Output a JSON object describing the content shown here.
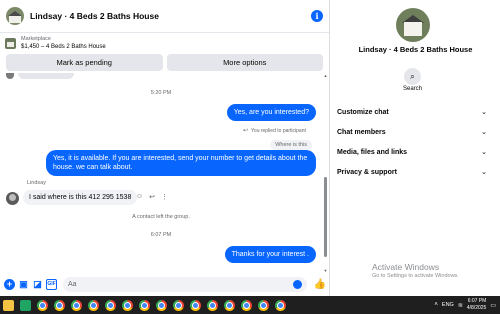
{
  "header": {
    "title": "Lindsay · 4 Beds 2 Baths House",
    "info_icon": "i"
  },
  "marketplace": {
    "label": "Marketplace",
    "item": "$1,450 – 4 Beds 2 Baths House"
  },
  "actions": {
    "mark_pending": "Mark as pending",
    "more_options": "More options"
  },
  "messages": {
    "time1": "5:20 PM",
    "out1": "Yes, are you interested?",
    "replied_note": "You replied to participant",
    "quoted": "Where is this",
    "out2": "Yes, it is available. If you are interested, send your number to get details about the house. we can talk about.",
    "sender": "Lindsay",
    "in1": "I said where is this 412 295 1538",
    "system": "A contact left the group.",
    "time2": "6:07 PM",
    "out3": "Thanks for your interest ."
  },
  "composer": {
    "placeholder": "Aa"
  },
  "info_panel": {
    "name": "Lindsay · 4 Beds 2 Baths House",
    "search_label": "Search",
    "menu": [
      "Customize chat",
      "Chat members",
      "Media, files and links",
      "Privacy & support"
    ]
  },
  "watermark": {
    "title": "Activate Windows",
    "subtitle": "Go to Settings to activate Windows."
  },
  "taskbar": {
    "lang": "ENG",
    "time": "6:07 PM",
    "date": "4/8/2025"
  }
}
